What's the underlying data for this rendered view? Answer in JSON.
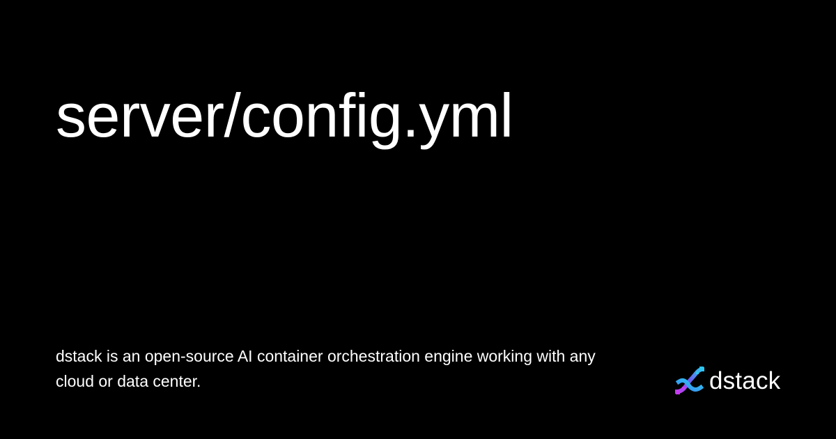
{
  "title": "server/config.yml",
  "description": "dstack is an open-source AI container orchestration engine working with any cloud or data center.",
  "brand": {
    "name": "dstack",
    "logo_icon": "dna-helix-icon",
    "gradient_colors": [
      "#2ec5f0",
      "#5a6cf0",
      "#c23cf0"
    ]
  },
  "background_color": "#000000",
  "text_color": "#ffffff"
}
